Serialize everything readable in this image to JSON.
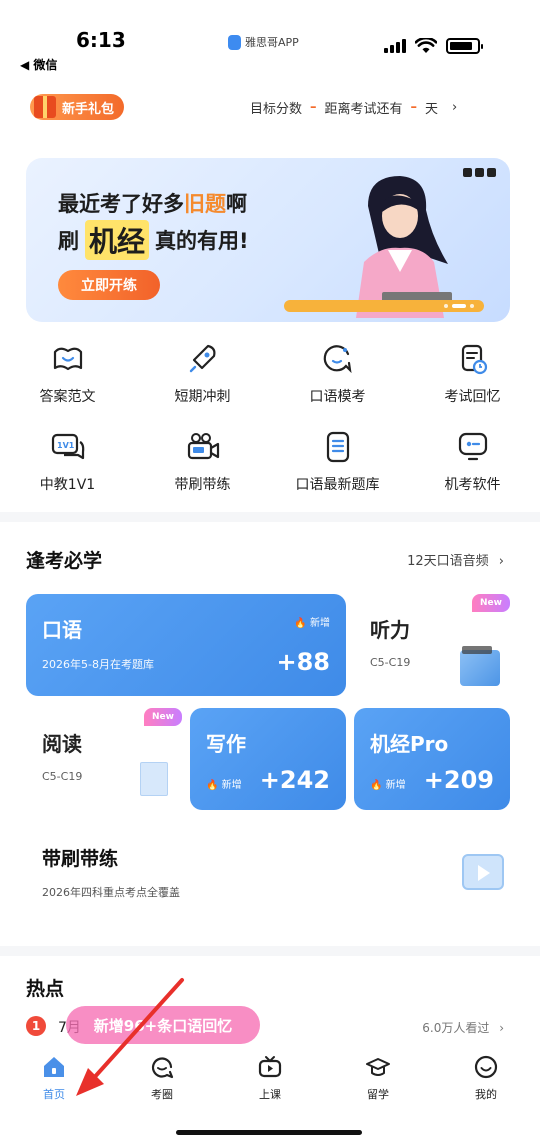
{
  "status_bar": {
    "time": "6:13",
    "back_app": "◀ 微信",
    "app_name": "雅思哥APP",
    "battery_level": 0.85
  },
  "header": {
    "gift_label": "新手礼包",
    "target_score_label": "目标分数",
    "score_dash": "–",
    "exam_countdown_label": "距离考试还有",
    "days_dash": "–",
    "days_unit": "天",
    "chevron": "›"
  },
  "banner": {
    "line1_prefix": "最近考了好多",
    "line1_highlight": "旧题",
    "line1_suffix": "啊",
    "line2_prefix": "刷",
    "line2_big": "机经",
    "line2_suffix": "真的有用!",
    "cta": "立即开练",
    "accent_color": "#f58a2d"
  },
  "quick_grid": [
    [
      {
        "label": "答案范文",
        "icon": "book-smile-icon"
      },
      {
        "label": "短期冲刺",
        "icon": "rocket-icon"
      },
      {
        "label": "口语模考",
        "icon": "mic-chat-icon"
      },
      {
        "label": "考试回忆",
        "icon": "note-clock-icon"
      }
    ],
    [
      {
        "label": "中教1V1",
        "icon": "one-on-one-chat-icon"
      },
      {
        "label": "带刷带练",
        "icon": "video-camera-icon"
      },
      {
        "label": "口语最新题库",
        "icon": "question-bank-icon"
      },
      {
        "label": "机考软件",
        "icon": "computer-test-icon"
      }
    ]
  ],
  "section": {
    "title": "逢考必学",
    "link": "12天口语音频",
    "chevron": "›"
  },
  "cards": {
    "speaking": {
      "title": "口语",
      "subtitle": "2026年5-8月在考题库",
      "badge": "🔥 新增",
      "number": "+88"
    },
    "listening": {
      "title": "听力",
      "subtitle": "C5-C19",
      "new_tag": "New"
    },
    "reading": {
      "title": "阅读",
      "subtitle": "C5-C19",
      "new_tag": "New"
    },
    "writing": {
      "title": "写作",
      "badge": "🔥 新增",
      "number": "+242"
    },
    "jijing": {
      "title": "机经Pro",
      "badge": "🔥 新增",
      "number": "+209"
    }
  },
  "practice": {
    "title": "带刷带练",
    "subtitle": "2026年四科重点考点全覆盖"
  },
  "hot": {
    "title": "热点",
    "rank": "1",
    "text": "7月",
    "views": "6.0万人看过",
    "chevron": "›",
    "toast": "新增96+条口语回忆"
  },
  "tabbar": [
    {
      "label": "首页",
      "icon": "home-icon",
      "active": true
    },
    {
      "label": "考圈",
      "icon": "chat-circle-icon",
      "active": false
    },
    {
      "label": "上课",
      "icon": "tv-play-icon",
      "active": false
    },
    {
      "label": "留学",
      "icon": "graduation-cap-icon",
      "active": false
    },
    {
      "label": "我的",
      "icon": "smiley-icon",
      "active": false
    }
  ],
  "colors": {
    "primary_blue": "#3f8be8",
    "orange": "#f2622a",
    "annotation_red": "#e8302b"
  }
}
